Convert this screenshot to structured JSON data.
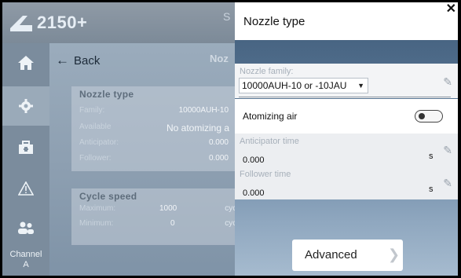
{
  "app": {
    "logo_text": "2150+",
    "header_side": "S"
  },
  "sidebar": {
    "channel_label": "Channel",
    "channel_value": "A"
  },
  "main": {
    "back_label": "Back",
    "title_partial": "Noz",
    "nozzle_card": {
      "title": "Nozzle type",
      "rows": [
        {
          "label": "Family:",
          "value": "10000AUH-10"
        },
        {
          "label": "Available",
          "value": "No atomizing a"
        },
        {
          "label": "Anticipator:",
          "value": "0.000"
        },
        {
          "label": "Follower:",
          "value": "0.000"
        }
      ]
    },
    "cycle_card": {
      "title": "Cycle speed",
      "rows": [
        {
          "label": "Maximum:",
          "value": "1000",
          "unit": "cycle"
        },
        {
          "label": "Minimum:",
          "value": "0",
          "unit": "cycle"
        }
      ]
    }
  },
  "dialog": {
    "title": "Nozzle type",
    "close_glyph": "✕",
    "family_label": "Nozzle family:",
    "family_value": "10000AUH-10 or -10JAU",
    "air_label": "Atomizing air",
    "air_enabled": false,
    "anticipator_label": "Anticipator time",
    "anticipator_value": "0.000",
    "anticipator_unit": "s",
    "follower_label": "Follower time",
    "follower_value": "0.000",
    "follower_unit": "s",
    "advanced_label": "Advanced"
  },
  "colors": {
    "dialog_top": "#3e5a78",
    "dialog_bottom": "#a6bbcf",
    "sidebar": "#7b8c9d"
  },
  "icons": {
    "home": "home-icon",
    "settings": "gear-icon",
    "maintenance": "toolbox-icon",
    "alarm": "warning-icon",
    "users": "users-icon",
    "edit": "pencil-icon"
  }
}
